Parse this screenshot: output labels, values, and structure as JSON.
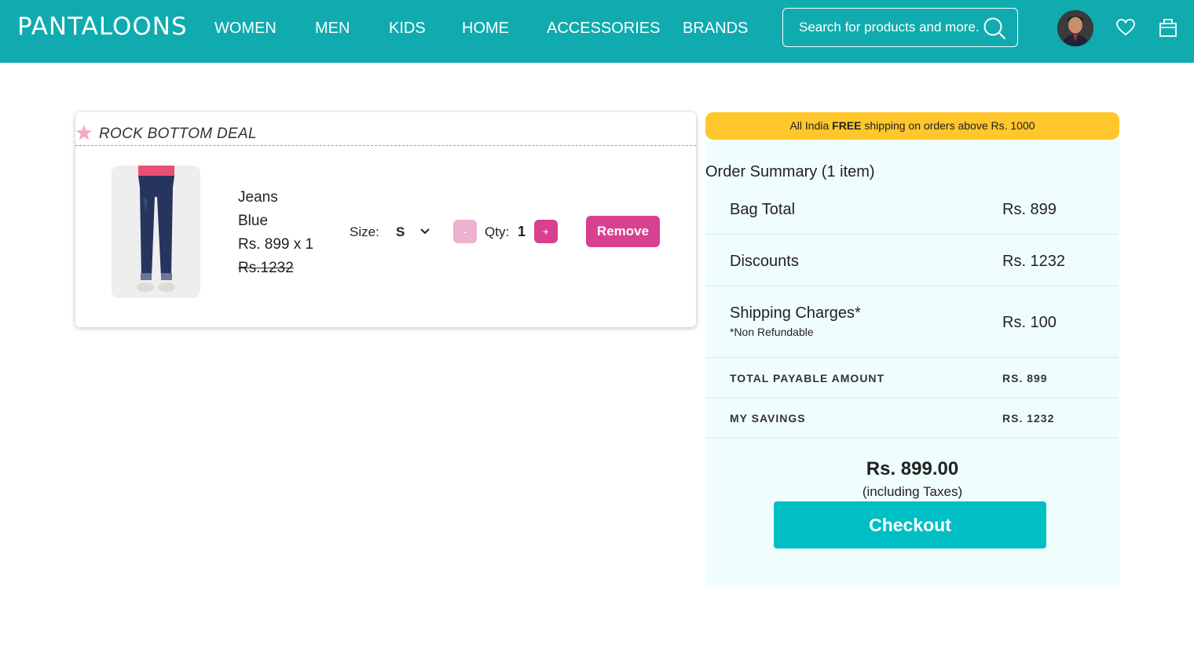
{
  "header": {
    "logo": "PANTALOONS",
    "nav": [
      "WOMEN",
      "MEN",
      "KIDS",
      "HOME",
      "ACCESSORIES",
      "BRANDS"
    ],
    "search_placeholder": "Search for products and more."
  },
  "cart": {
    "deal_label": "ROCK BOTTOM DEAL",
    "item": {
      "name": "Jeans",
      "color": "Blue",
      "price_line": "Rs. 899 x 1",
      "original_price": "Rs.1232",
      "size_label": "Size:",
      "size_value": "S",
      "minus_label": "-",
      "qty_label": "Qty:",
      "qty_value": "1",
      "plus_label": "+",
      "remove_label": "Remove"
    }
  },
  "summary": {
    "shipping_banner_pre": "All India ",
    "shipping_banner_bold": "FREE",
    "shipping_banner_post": " shipping on orders above Rs. 1000",
    "title": "Order Summary (1 item)",
    "bag_total_label": "Bag Total",
    "bag_total_value": "Rs. 899",
    "discounts_label": "Discounts",
    "discounts_value": "Rs. 1232",
    "shipping_label": "Shipping Charges*",
    "shipping_note": "*Non Refundable",
    "shipping_value": "Rs. 100",
    "total_label": "TOTAL PAYABLE AMOUNT",
    "total_value": "RS. 899",
    "savings_label": "MY SAVINGS",
    "savings_value": "RS. 1232",
    "grand_total": "Rs. 899.00",
    "tax_note": "(including Taxes)",
    "checkout_label": "Checkout"
  },
  "colors": {
    "header_bg": "#0fabaf",
    "accent_pink": "#d7418f",
    "banner_yellow": "#ffc72c",
    "checkout_teal": "#00bfc4"
  }
}
